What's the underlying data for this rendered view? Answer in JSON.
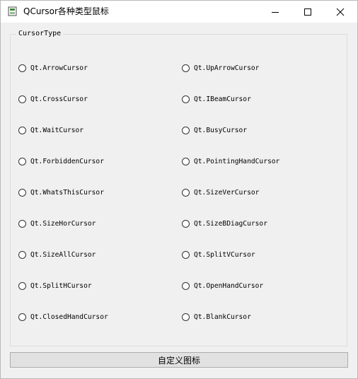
{
  "window": {
    "title": "QCursor各种类型鼠标"
  },
  "group": {
    "title": "CursorType"
  },
  "cursors": {
    "left": [
      "Qt.ArrowCursor",
      "Qt.CrossCursor",
      "Qt.WaitCursor",
      "Qt.ForbiddenCursor",
      "Qt.WhatsThisCursor",
      "Qt.SizeHorCursor",
      "Qt.SizeAllCursor",
      "Qt.SplitHCursor",
      "Qt.ClosedHandCursor"
    ],
    "right": [
      "Qt.UpArrowCursor",
      "Qt.IBeamCursor",
      "Qt.BusyCursor",
      "Qt.PointingHandCursor",
      "Qt.SizeVerCursor",
      "Qt.SizeBDiagCursor",
      "Qt.SplitVCursor",
      "Qt.OpenHandCursor",
      "Qt.BlankCursor"
    ]
  },
  "button": {
    "label": "自定义图标"
  },
  "icons": {
    "app": "qt-app-icon",
    "minimize": "minimize-icon",
    "maximize": "maximize-icon",
    "close": "close-icon",
    "radio": "radio-unchecked-icon"
  }
}
